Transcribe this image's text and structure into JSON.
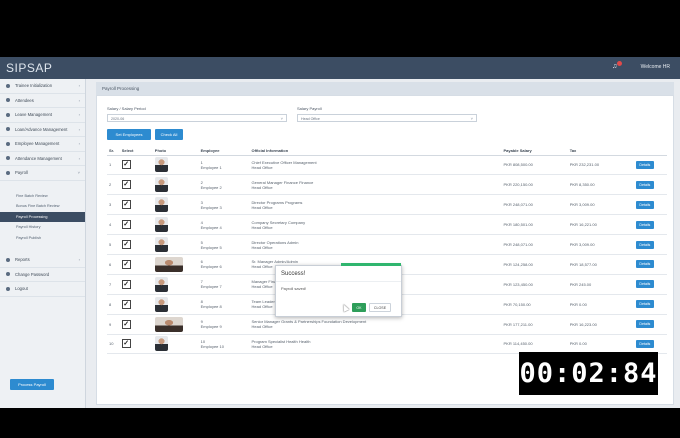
{
  "app": {
    "logo": "SIPSAP",
    "welcome": "Welcome HR"
  },
  "sidebar": {
    "items": [
      {
        "label": "Trainee Initialization"
      },
      {
        "label": "Attendees"
      },
      {
        "label": "Leave Management"
      },
      {
        "label": "Loan/Advance Management"
      },
      {
        "label": "Employee Management"
      },
      {
        "label": "Attendance Management"
      },
      {
        "label": "Payroll"
      }
    ],
    "payroll_subitems": [
      {
        "label": "Fine Batch Review",
        "active": false
      },
      {
        "label": "Bonus Fine Batch Review",
        "active": false
      },
      {
        "label": "Payroll Processing",
        "active": true
      },
      {
        "label": "Payroll History",
        "active": false
      },
      {
        "label": "Payroll Publish",
        "active": false
      }
    ],
    "bottom_items": [
      {
        "label": "Reports"
      },
      {
        "label": "Change Password"
      },
      {
        "label": "Logout"
      }
    ]
  },
  "panel": {
    "title": "Payroll Processing",
    "filter1_label": "Salary / Salary Period",
    "filter1_value": "2020-06",
    "filter2_label": "Salary Payroll",
    "filter2_value": "Head Office",
    "btn_set_employees": "Set Employees",
    "btn_check_all": "Check All",
    "btn_process_payroll": "Process Payroll"
  },
  "table": {
    "headers": [
      "Sr.",
      "Select",
      "Photo",
      "Employee",
      "Official Information",
      "Payable Salary",
      "Tax",
      ""
    ],
    "rows": [
      {
        "sr": "1",
        "emp_no": "1",
        "emp_name": "Employee 1",
        "designation": "Chief Executive Officer Management",
        "office": "Head Office",
        "salary": "PKR 808,500.00",
        "tax": "PKR 232,231.00",
        "wide": false
      },
      {
        "sr": "2",
        "emp_no": "2",
        "emp_name": "Employee 2",
        "designation": "General Manager Finance Finance",
        "office": "Head Office",
        "salary": "PKR 220,150.00",
        "tax": "PKR 8,350.00",
        "wide": false
      },
      {
        "sr": "3",
        "emp_no": "3",
        "emp_name": "Employee 3",
        "designation": "Director Programs Programs",
        "office": "Head Office",
        "salary": "PKR 248,071.00",
        "tax": "PKR 3,009.00",
        "wide": false
      },
      {
        "sr": "4",
        "emp_no": "4",
        "emp_name": "Employee 4",
        "designation": "Company Secretary Company",
        "office": "Head Office",
        "salary": "PKR 180,501.00",
        "tax": "PKR 16,221.00",
        "wide": false
      },
      {
        "sr": "5",
        "emp_no": "5",
        "emp_name": "Employee 5",
        "designation": "Director Operations Admin",
        "office": "Head Office",
        "salary": "PKR 248,071.00",
        "tax": "PKR 3,009.00",
        "wide": false
      },
      {
        "sr": "6",
        "emp_no": "6",
        "emp_name": "Employee 6",
        "designation": "Sr. Manager Admin/Admin",
        "office": "Head Office",
        "salary": "PKR 124,258.00",
        "tax": "PKR 18,577.00",
        "wide": true
      },
      {
        "sr": "7",
        "emp_no": "7",
        "emp_name": "Employee 7",
        "designation": "Manager Finance Finance",
        "office": "Head Office",
        "salary": "PKR 123,450.00",
        "tax": "PKR 245.00",
        "wide": false
      },
      {
        "sr": "8",
        "emp_no": "8",
        "emp_name": "Employee 8",
        "designation": "Team Leader Sustainable Environment",
        "office": "Head Office",
        "salary": "PKR 70,150.00",
        "tax": "PKR 0.00",
        "wide": false
      },
      {
        "sr": "9",
        "emp_no": "9",
        "emp_name": "Employee 9",
        "designation": "Senior Manager Grants & Partnerships Foundation Development",
        "office": "Head Office",
        "salary": "PKR 177,211.00",
        "tax": "PKR 16,223.00",
        "wide": true
      },
      {
        "sr": "10",
        "emp_no": "10",
        "emp_name": "Employee 10",
        "designation": "Program Specialist Health Health",
        "office": "Head Office",
        "salary": "PKR 114,450.00",
        "tax": "PKR 0.00",
        "wide": false
      }
    ],
    "action_label": "Details"
  },
  "modal": {
    "title": "Success!",
    "message": "Payroll saved!",
    "ok_label": "OK",
    "close_label": "CLOSE"
  },
  "timer": "00:02:84",
  "colors": {
    "topbar": "#3c4d63",
    "accent_blue": "#2d8bd0",
    "ok_green": "#2e9e5a"
  }
}
